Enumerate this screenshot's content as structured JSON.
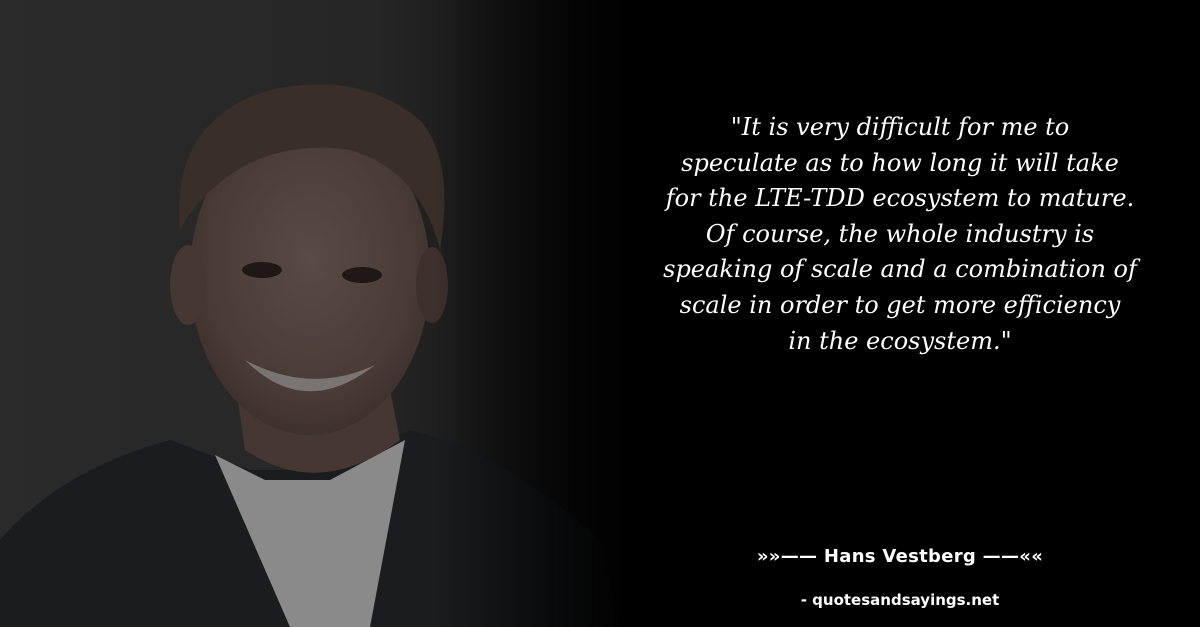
{
  "quote": {
    "lines": [
      "\"It is very difficult for me to",
      "speculate as to how long it will take",
      "for the LTE-TDD ecosystem to mature.",
      "Of course, the whole industry is",
      "speaking of scale and a combination of",
      "scale in order to get more efficiency",
      "in the ecosystem.\""
    ]
  },
  "attribution": {
    "author_line": "»»—— Hans Vestberg ——««",
    "source_line": "- quotesandsayings.net"
  },
  "colors": {
    "background": "#000000",
    "text": "#ffffff"
  }
}
